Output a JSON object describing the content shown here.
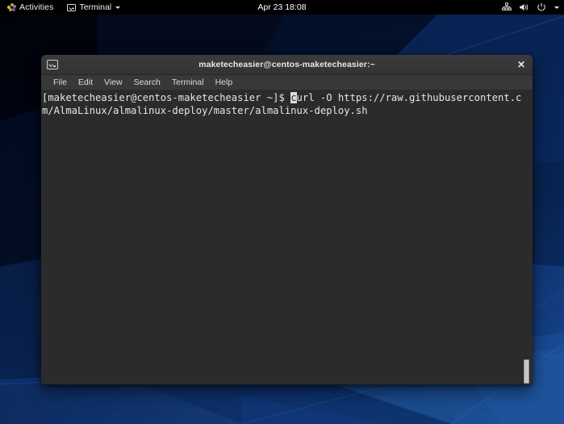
{
  "topbar": {
    "activities_label": "Activities",
    "activities_icon": "gnome-logo-icon",
    "app_menu_label": "Terminal",
    "app_menu_icon": "terminal-icon",
    "app_menu_caret": "chevron-down-icon",
    "clock": "Apr 23  18:08",
    "status_icons": [
      "network-wired-icon",
      "volume-icon",
      "power-icon",
      "chevron-down-icon"
    ],
    "background_color": "#000000"
  },
  "window": {
    "title": "maketecheasier@centos-maketecheasier:~",
    "titlebar_icon": "terminal-icon",
    "close_label": "✕",
    "menu": [
      {
        "label": "File"
      },
      {
        "label": "Edit"
      },
      {
        "label": "View"
      },
      {
        "label": "Search"
      },
      {
        "label": "Terminal"
      },
      {
        "label": "Help"
      }
    ],
    "terminal": {
      "prompt": "[maketecheasier@centos-maketecheasier ~]$ ",
      "cursor_char": "c",
      "command_rest": "url -O https://raw.githubusercontent.com/AlmaLinux/almalinux-deploy/master/almalinux-deploy.sh",
      "foreground_color": "#e6e6e6",
      "background_color": "#2b2b2b",
      "cursor_color": "#dcdcdc"
    },
    "scrollbar": {
      "thumb_label": "scrollbar-thumb"
    }
  },
  "desktop": {
    "wallpaper_name": "centos-blue-polygon-wallpaper",
    "colors": {
      "dark": "#03081c",
      "mid": "#0b2252",
      "bright": "#1a4a94"
    }
  }
}
